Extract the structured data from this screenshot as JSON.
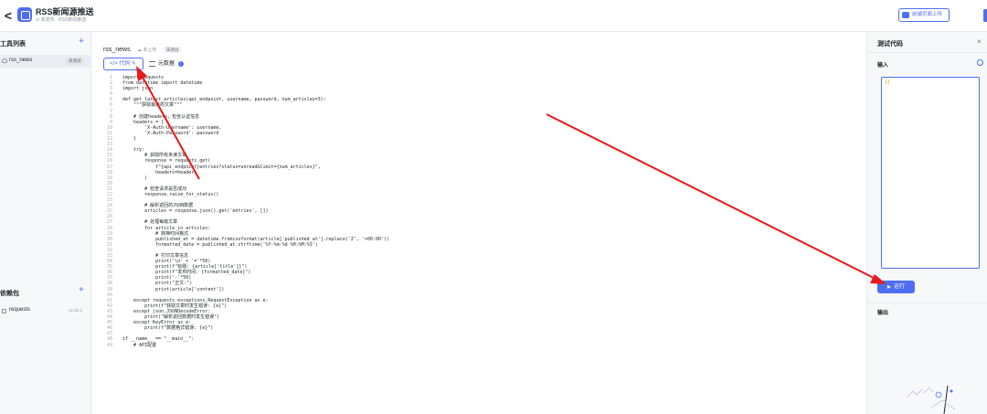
{
  "header": {
    "back_label": "<",
    "title": "RSS新闻源推送",
    "subtitle": "⊙ 未发布 · RSS新闻推送",
    "publish_label": "前端页面上传"
  },
  "left_panel": {
    "tools_title": "工具列表",
    "add_label": "+",
    "tools": [
      {
        "name": "rss_news",
        "tag": "未测试"
      }
    ],
    "deps_title": "依赖包",
    "deps": [
      {
        "name": "requests",
        "version": "v2.32.3"
      }
    ]
  },
  "editor": {
    "file_name": "rss_news",
    "file_meta": "☁ 未上传",
    "file_tag": "未测试",
    "tab_code": "</> 代码 ✎",
    "tab_meta": "元数据",
    "tab_meta_info": "i",
    "gutter_mark": "?",
    "lines": [
      {
        "n": "1",
        "t": "import requests"
      },
      {
        "n": "2",
        "t": "from datetime import datetime"
      },
      {
        "n": "3",
        "t": "import json"
      },
      {
        "n": "4",
        "t": ""
      },
      {
        "n": "5",
        "t": "def get_latest_articles(api_endpoint, username, password, num_articles=3):"
      },
      {
        "n": "6",
        "t": "    \"\"\"获取最新的文章\"\"\""
      },
      {
        "n": "7",
        "t": ""
      },
      {
        "n": "8",
        "t": "    # 创建headers，包含认证信息"
      },
      {
        "n": "9",
        "t": "    headers = {"
      },
      {
        "n": "10",
        "t": "        'X-Auth-Username': username,"
      },
      {
        "n": "11",
        "t": "        'X-Auth-Password': password"
      },
      {
        "n": "12",
        "t": "    }"
      },
      {
        "n": "13",
        "t": ""
      },
      {
        "n": "14",
        "t": "    try:"
      },
      {
        "n": "15",
        "t": "        # 获取所有未读文章"
      },
      {
        "n": "16",
        "t": "        response = requests.get("
      },
      {
        "n": "17",
        "t": "            f\"{api_endpoint}entries?status=unread&limit={num_articles}\","
      },
      {
        "n": "18",
        "t": "            headers=headers"
      },
      {
        "n": "19",
        "t": "        )"
      },
      {
        "n": "20",
        "t": ""
      },
      {
        "n": "21",
        "t": "        # 检查请求是否成功"
      },
      {
        "n": "22",
        "t": "        response.raise_for_status()"
      },
      {
        "n": "23",
        "t": ""
      },
      {
        "n": "24",
        "t": "        # 解析返回的JSON数据"
      },
      {
        "n": "25",
        "t": "        articles = response.json().get('entries', [])"
      },
      {
        "n": "26",
        "t": ""
      },
      {
        "n": "27",
        "t": "        # 处理每篇文章"
      },
      {
        "n": "28",
        "t": "        for article in articles:"
      },
      {
        "n": "29",
        "t": "            # 转换时间格式"
      },
      {
        "n": "30",
        "t": "            published_at = datetime.fromisoformat(article['published_at'].replace('Z', '+00:00'))"
      },
      {
        "n": "31",
        "t": "            formatted_date = published_at.strftime('%Y-%m-%d %H:%M:%S')"
      },
      {
        "n": "32",
        "t": ""
      },
      {
        "n": "33",
        "t": "            # 打印文章信息"
      },
      {
        "n": "34",
        "t": "            print('\\n' + '='*50)"
      },
      {
        "n": "35",
        "t": "            print(f\"标题: {article['title']}\")"
      },
      {
        "n": "36",
        "t": "            print(f\"发布时间: {formatted_date}\")"
      },
      {
        "n": "37",
        "t": "            print('-'*50)"
      },
      {
        "n": "38",
        "t": "            print(\"正文:\")"
      },
      {
        "n": "39",
        "t": "            print(article['content'])"
      },
      {
        "n": "40",
        "t": ""
      },
      {
        "n": "41",
        "t": "    except requests.exceptions.RequestException as e:"
      },
      {
        "n": "42",
        "t": "        print(f\"获取文章时发生错误: {e}\")"
      },
      {
        "n": "43",
        "t": "    except json.JSONDecodeError:"
      },
      {
        "n": "44",
        "t": "        print(\"解析返回数据时发生错误\")"
      },
      {
        "n": "45",
        "t": "    except KeyError as e:"
      },
      {
        "n": "46",
        "t": "        print(f\"数据格式错误: {e}\")"
      },
      {
        "n": "47",
        "t": ""
      },
      {
        "n": "48",
        "t": "if __name__ == \"__main__\":"
      },
      {
        "n": "49",
        "t": "    # API配置"
      }
    ]
  },
  "right_panel": {
    "title": "测试代码",
    "close_label": "×",
    "input_label": "输入",
    "input_value": "{}",
    "run_label": "运行",
    "output_label": "输出"
  },
  "colors": {
    "accent": "#4e6ef2",
    "annotation_arrow": "#e8191b"
  }
}
